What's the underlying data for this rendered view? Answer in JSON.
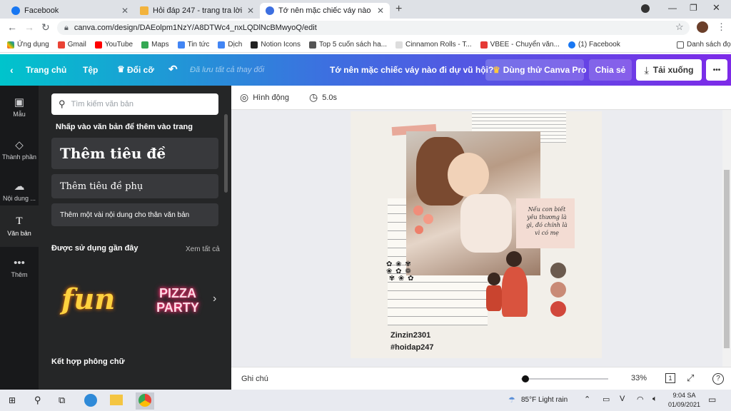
{
  "browser": {
    "tabs": [
      {
        "label": "Facebook",
        "active": false
      },
      {
        "label": "Hỏi đáp 247 - trang tra lời",
        "active": false
      },
      {
        "label": "Tớ nên mặc chiếc váy nào đi dự v",
        "active": true
      }
    ],
    "new_tab": "+",
    "url": "canva.com/design/DAEolpm1NzY/A8DTWc4_nxLQDlNcBMwyoQ/edit",
    "bookmarks": [
      "Ứng dụng",
      "Gmail",
      "YouTube",
      "Maps",
      "Tin tức",
      "Dịch",
      "Notion Icons",
      "Top 5 cuốn sách ha...",
      "Cinnamon Rolls - T...",
      "VBEE - Chuyển văn...",
      "(1) Facebook"
    ],
    "reading_list": "Danh sách đọc"
  },
  "header": {
    "home": "Trang chủ",
    "file": "Tệp",
    "resize": "Đổi cỡ",
    "saved": "Đã lưu tất cả thay đổi",
    "title": "Tớ nên mặc chiếc váy nào đi dự vũ hội?",
    "pro": "Dùng thử Canva Pro",
    "share": "Chia sẻ",
    "download": "Tải xuống",
    "more": "•••"
  },
  "rail": [
    {
      "label": "Mẫu",
      "icon": "template-icon"
    },
    {
      "label": "Thành phần",
      "icon": "elements-icon"
    },
    {
      "label": "Nội dung ...",
      "icon": "upload-icon"
    },
    {
      "label": "Văn bản",
      "icon": "text-icon"
    },
    {
      "label": "Thêm",
      "icon": "more-icon"
    }
  ],
  "panel": {
    "search_placeholder": "Tìm kiếm văn bản",
    "hint": "Nhấp vào văn bản để thêm vào trang",
    "heading": "Thêm tiêu đề",
    "subheading": "Thêm tiêu đề phụ",
    "body": "Thêm một vài nội dung cho thân văn bản",
    "recent": "Được sử dụng gần đây",
    "see_all": "Xem tất cả",
    "sample1": "fun",
    "sample2_line1": "PIZZA",
    "sample2_line2": "PARTY",
    "combos": "Kết hợp phông chữ"
  },
  "canvas": {
    "animate": "Hình động",
    "duration": "5.0s",
    "notes": "Ghi chú",
    "zoom": "33%",
    "page_num": "1",
    "help": "?",
    "zoom_level": 0.05
  },
  "design": {
    "handwriting": "Nếu con biết yêu thương là gì, đó chính là vì có mẹ",
    "user": "Zinzin2301",
    "tag": "#hoidap247",
    "swatches": [
      "#6b5a4e",
      "#c98a76",
      "#d1473b"
    ]
  },
  "taskbar": {
    "weather": "85°F  Light rain",
    "time": "9:04 SA",
    "date": "01/09/2021"
  }
}
